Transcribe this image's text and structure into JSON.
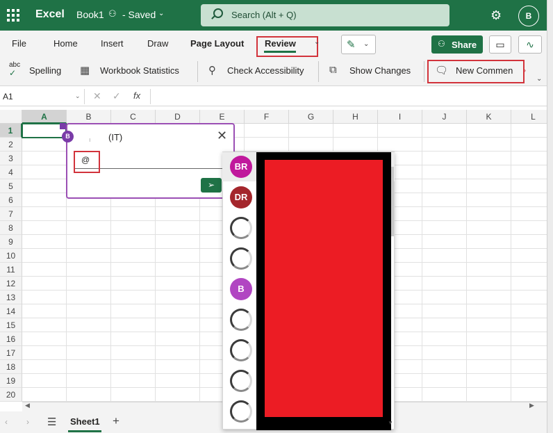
{
  "titlebar": {
    "app_name": "Excel",
    "doc_name": "Book1",
    "doc_status": "- Saved",
    "search_placeholder": "Search (Alt + Q)",
    "user_initial": "B"
  },
  "menu": {
    "tabs": [
      "File",
      "Home",
      "Insert",
      "Draw",
      "Page Layout",
      "Review"
    ],
    "share_label": "Share"
  },
  "ribbon": {
    "spelling": "Spelling",
    "spelling_icon_text": "abc",
    "workbook_statistics": "Workbook Statistics",
    "check_accessibility": "Check Accessibility",
    "show_changes": "Show Changes",
    "new_comment": "New Commen"
  },
  "formula_bar": {
    "name_box": "A1",
    "fx": "fx"
  },
  "grid": {
    "columns": [
      "A",
      "B",
      "C",
      "D",
      "E",
      "F",
      "G",
      "H",
      "I",
      "J",
      "K",
      "L"
    ],
    "rows": [
      "1",
      "2",
      "3",
      "4",
      "5",
      "6",
      "7",
      "8",
      "9",
      "10",
      "11",
      "12",
      "13",
      "14",
      "15",
      "16",
      "17",
      "18",
      "19",
      "20"
    ],
    "selected_column": "A",
    "selected_row": "1"
  },
  "comment": {
    "avatar_initial": "B",
    "author": "(IT)",
    "input_value": "@"
  },
  "mentions": [
    {
      "type": "initials",
      "initials": "BR",
      "color": "#c0189c"
    },
    {
      "type": "initials",
      "initials": "DR",
      "color": "#a4262c"
    },
    {
      "type": "photo"
    },
    {
      "type": "photo"
    },
    {
      "type": "initials",
      "initials": "B",
      "color": "#b146c2"
    },
    {
      "type": "photo"
    },
    {
      "type": "photo"
    },
    {
      "type": "photo"
    },
    {
      "type": "photo"
    }
  ],
  "sheets": {
    "active": "Sheet1"
  },
  "colors": {
    "excel_green": "#1f7246",
    "highlight_red": "#d2333b",
    "comment_purple": "#9b4fb4",
    "redaction_red": "#ec1c24"
  }
}
